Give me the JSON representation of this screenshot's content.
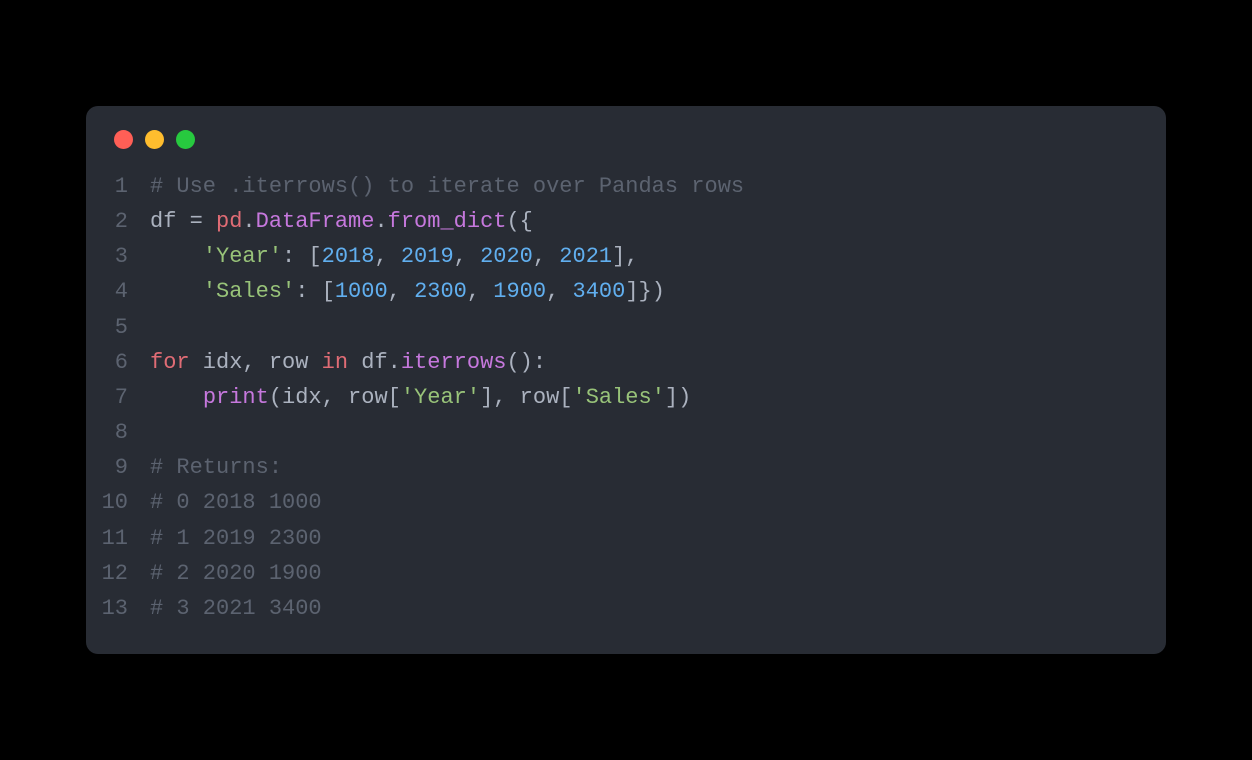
{
  "window": {
    "traffic_lights": {
      "red": "#ff5f56",
      "yellow": "#ffbd2e",
      "green": "#27c93f"
    }
  },
  "code": {
    "lines": [
      {
        "num": "1",
        "tokens": [
          {
            "t": "# Use .iterrows() to iterate over Pandas rows",
            "c": "tok-comment"
          }
        ]
      },
      {
        "num": "2",
        "tokens": [
          {
            "t": "df ",
            "c": "tok-var"
          },
          {
            "t": "=",
            "c": "tok-op"
          },
          {
            "t": " pd",
            "c": "tok-attr"
          },
          {
            "t": ".",
            "c": "tok-punct"
          },
          {
            "t": "DataFrame",
            "c": "tok-func"
          },
          {
            "t": ".",
            "c": "tok-punct"
          },
          {
            "t": "from_dict",
            "c": "tok-method"
          },
          {
            "t": "({",
            "c": "tok-punct"
          }
        ]
      },
      {
        "num": "3",
        "tokens": [
          {
            "t": "    ",
            "c": "tok-var"
          },
          {
            "t": "'Year'",
            "c": "tok-string"
          },
          {
            "t": ": [",
            "c": "tok-punct"
          },
          {
            "t": "2018",
            "c": "tok-number"
          },
          {
            "t": ", ",
            "c": "tok-punct"
          },
          {
            "t": "2019",
            "c": "tok-number"
          },
          {
            "t": ", ",
            "c": "tok-punct"
          },
          {
            "t": "2020",
            "c": "tok-number"
          },
          {
            "t": ", ",
            "c": "tok-punct"
          },
          {
            "t": "2021",
            "c": "tok-number"
          },
          {
            "t": "],",
            "c": "tok-punct"
          }
        ]
      },
      {
        "num": "4",
        "tokens": [
          {
            "t": "    ",
            "c": "tok-var"
          },
          {
            "t": "'Sales'",
            "c": "tok-string"
          },
          {
            "t": ": [",
            "c": "tok-punct"
          },
          {
            "t": "1000",
            "c": "tok-number"
          },
          {
            "t": ", ",
            "c": "tok-punct"
          },
          {
            "t": "2300",
            "c": "tok-number"
          },
          {
            "t": ", ",
            "c": "tok-punct"
          },
          {
            "t": "1900",
            "c": "tok-number"
          },
          {
            "t": ", ",
            "c": "tok-punct"
          },
          {
            "t": "3400",
            "c": "tok-number"
          },
          {
            "t": "]})",
            "c": "tok-punct"
          }
        ]
      },
      {
        "num": "5",
        "tokens": []
      },
      {
        "num": "6",
        "tokens": [
          {
            "t": "for",
            "c": "tok-keyword"
          },
          {
            "t": " idx, row ",
            "c": "tok-var"
          },
          {
            "t": "in",
            "c": "tok-keyword2"
          },
          {
            "t": " df",
            "c": "tok-var"
          },
          {
            "t": ".",
            "c": "tok-punct"
          },
          {
            "t": "iterrows",
            "c": "tok-method"
          },
          {
            "t": "():",
            "c": "tok-punct"
          }
        ]
      },
      {
        "num": "7",
        "tokens": [
          {
            "t": "    ",
            "c": "tok-var"
          },
          {
            "t": "print",
            "c": "tok-builtin"
          },
          {
            "t": "(idx, row[",
            "c": "tok-punct"
          },
          {
            "t": "'Year'",
            "c": "tok-string"
          },
          {
            "t": "], row[",
            "c": "tok-punct"
          },
          {
            "t": "'Sales'",
            "c": "tok-string"
          },
          {
            "t": "])",
            "c": "tok-punct"
          }
        ]
      },
      {
        "num": "8",
        "tokens": []
      },
      {
        "num": "9",
        "tokens": [
          {
            "t": "# Returns:",
            "c": "tok-comment"
          }
        ]
      },
      {
        "num": "10",
        "tokens": [
          {
            "t": "# 0 2018 1000",
            "c": "tok-comment"
          }
        ]
      },
      {
        "num": "11",
        "tokens": [
          {
            "t": "# 1 2019 2300",
            "c": "tok-comment"
          }
        ]
      },
      {
        "num": "12",
        "tokens": [
          {
            "t": "# 2 2020 1900",
            "c": "tok-comment"
          }
        ]
      },
      {
        "num": "13",
        "tokens": [
          {
            "t": "# 3 2021 3400",
            "c": "tok-comment"
          }
        ]
      }
    ]
  }
}
